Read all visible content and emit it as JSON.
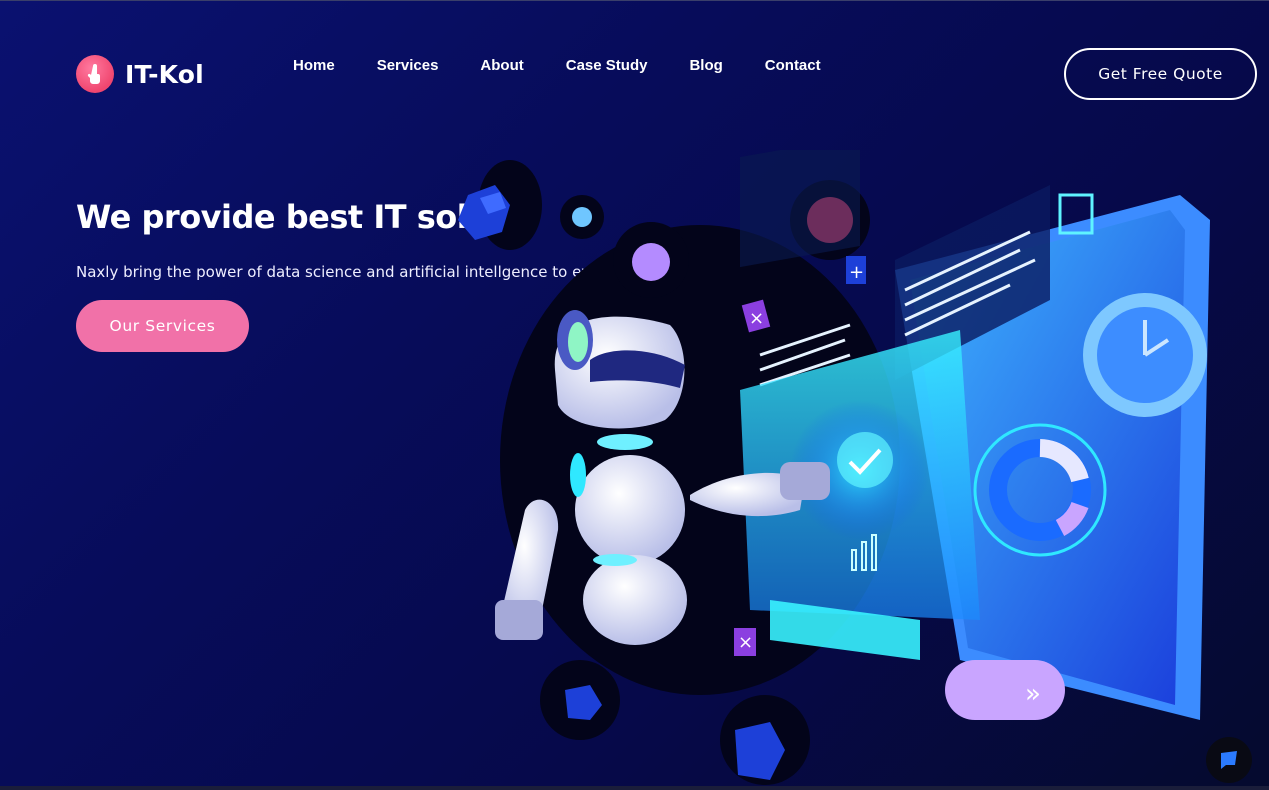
{
  "brand": {
    "name": "IT-Kol"
  },
  "nav": {
    "items": [
      {
        "label": "Home"
      },
      {
        "label": "Services"
      },
      {
        "label": "About"
      },
      {
        "label": "Case Study"
      },
      {
        "label": "Blog"
      },
      {
        "label": "Contact"
      }
    ]
  },
  "header": {
    "quote_label": "Get Free Quote"
  },
  "hero": {
    "title": "We provide best IT solutio",
    "subtitle": "Naxly bring the power of data science and artificial intellgence to every b",
    "cta_label": "Our Services"
  },
  "colors": {
    "accent_pink": "#f171a8",
    "logo_pink": "#f0466f",
    "background": "#070c5a",
    "screen_cyan": "#28e6ff"
  },
  "icons": {
    "logo": "hand-tap-icon",
    "chat": "chat-icon"
  }
}
